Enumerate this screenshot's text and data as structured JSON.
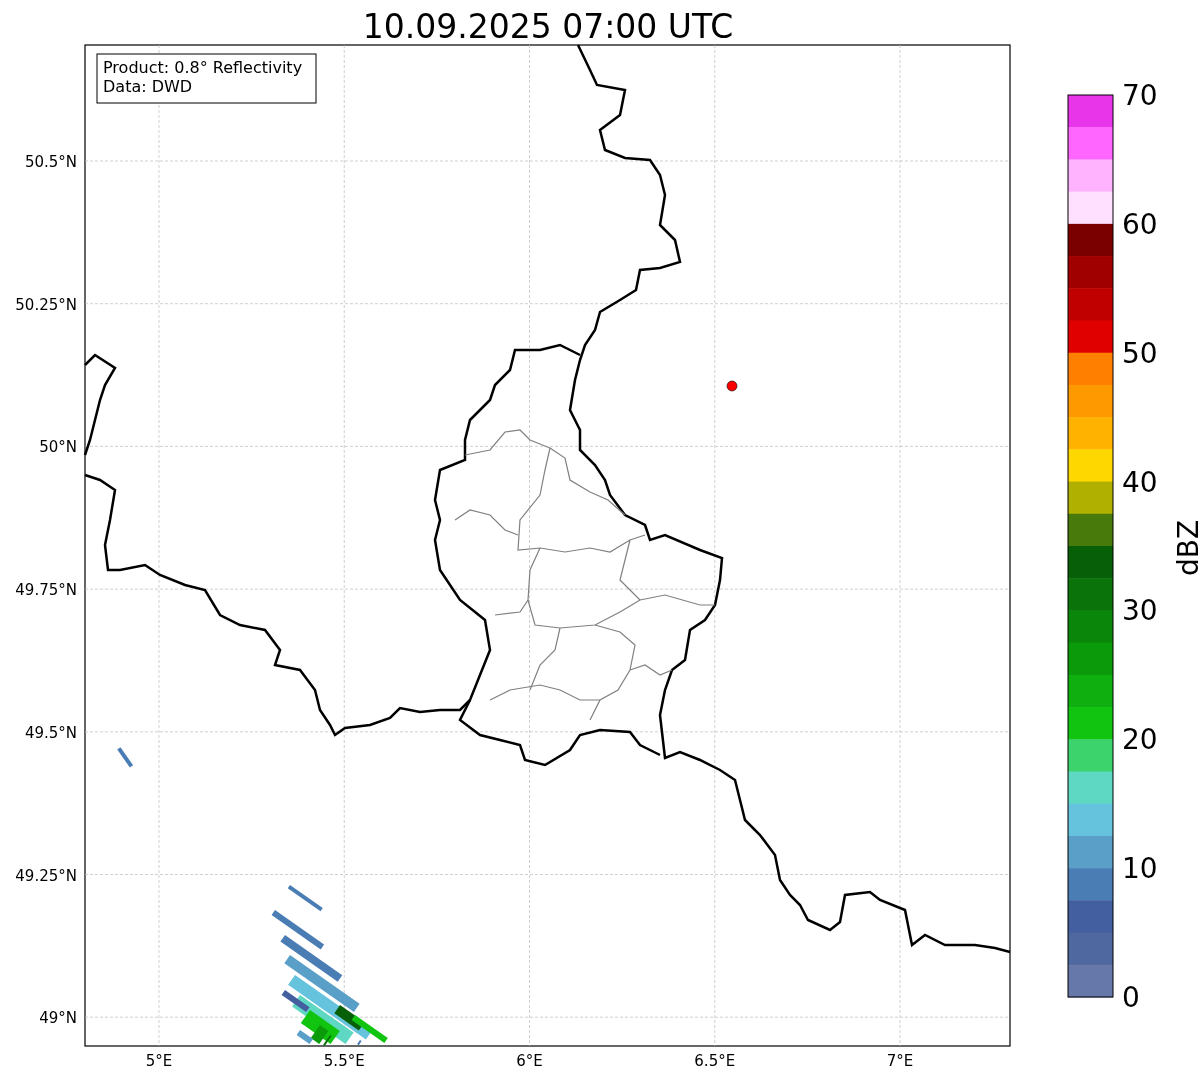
{
  "title": "10.09.2025 07:00 UTC",
  "info_box": {
    "lines": [
      "Product: 0.8° Reflectivity",
      "Data: DWD"
    ]
  },
  "axes": {
    "y_ticks": [
      "50.5°N",
      "50.25°N",
      "50°N",
      "49.75°N",
      "49.5°N",
      "49.25°N",
      "49°N"
    ],
    "x_ticks": [
      "5°E",
      "5.5°E",
      "6°E",
      "6.5°E",
      "7°E"
    ]
  },
  "marker": {
    "color": "#ff0000"
  },
  "colorbar": {
    "label": "dBZ",
    "ticks": [
      "70",
      "60",
      "50",
      "40",
      "30",
      "20",
      "10",
      "0"
    ],
    "bins": [
      {
        "color": "#e935e9"
      },
      {
        "color": "#ff66ff"
      },
      {
        "color": "#ffb3ff"
      },
      {
        "color": "#ffe0ff"
      },
      {
        "color": "#7a0000"
      },
      {
        "color": "#a00000"
      },
      {
        "color": "#c00000"
      },
      {
        "color": "#e00000"
      },
      {
        "color": "#ff7f00"
      },
      {
        "color": "#ff9900"
      },
      {
        "color": "#ffb300"
      },
      {
        "color": "#ffd700"
      },
      {
        "color": "#b0b000"
      },
      {
        "color": "#477a0a"
      },
      {
        "color": "#075f07"
      },
      {
        "color": "#0a740a"
      },
      {
        "color": "#0a870a"
      },
      {
        "color": "#0a9a0a"
      },
      {
        "color": "#0faf0f"
      },
      {
        "color": "#10c410"
      },
      {
        "color": "#3cd26c"
      },
      {
        "color": "#5fd8c3"
      },
      {
        "color": "#66c3dd"
      },
      {
        "color": "#5a9fc8"
      },
      {
        "color": "#4a7db4"
      },
      {
        "color": "#435fa0"
      },
      {
        "color": "#5068a0"
      },
      {
        "color": "#6677aa"
      }
    ]
  }
}
